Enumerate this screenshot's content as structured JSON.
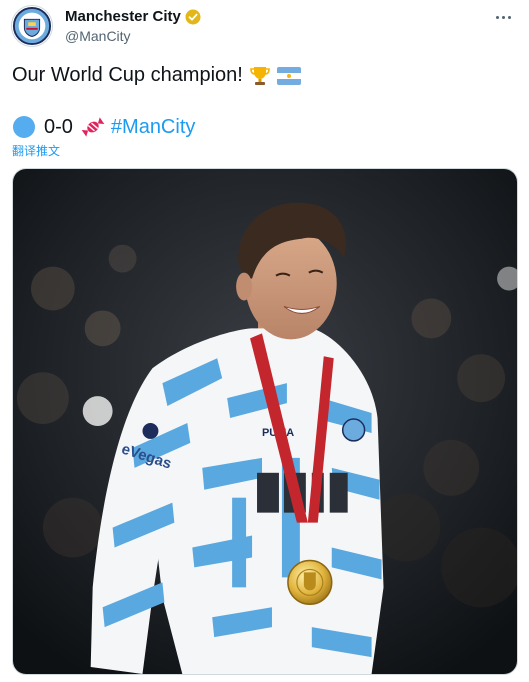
{
  "author": {
    "display_name": "Manchester City",
    "handle": "@ManCity",
    "avatar_icon": "club-crest-icon",
    "verified_icon": "verified-badge-icon",
    "verified_color": "#e2b719"
  },
  "menu": {
    "icon": "more-options-icon"
  },
  "tweet": {
    "line1_text": "Our World Cup champion!",
    "line1_emojis": [
      "trophy-emoji",
      "argentina-flag-emoji"
    ],
    "score_text": "0-0",
    "score_icon": "blue-circle-emoji",
    "score_emoji_after": "candy-emoji",
    "hashtag": "#ManCity",
    "translate_label": "翻译推文"
  },
  "media": {
    "kind": "photo",
    "subject": "player-with-gold-medal-photo",
    "shirt_text": "eVegas",
    "shirt_brand": "PUMA",
    "accent_color": "#5aa8e0"
  },
  "colors": {
    "link": "#1d9bf0",
    "text": "#0f1419",
    "secondary": "#536471"
  }
}
